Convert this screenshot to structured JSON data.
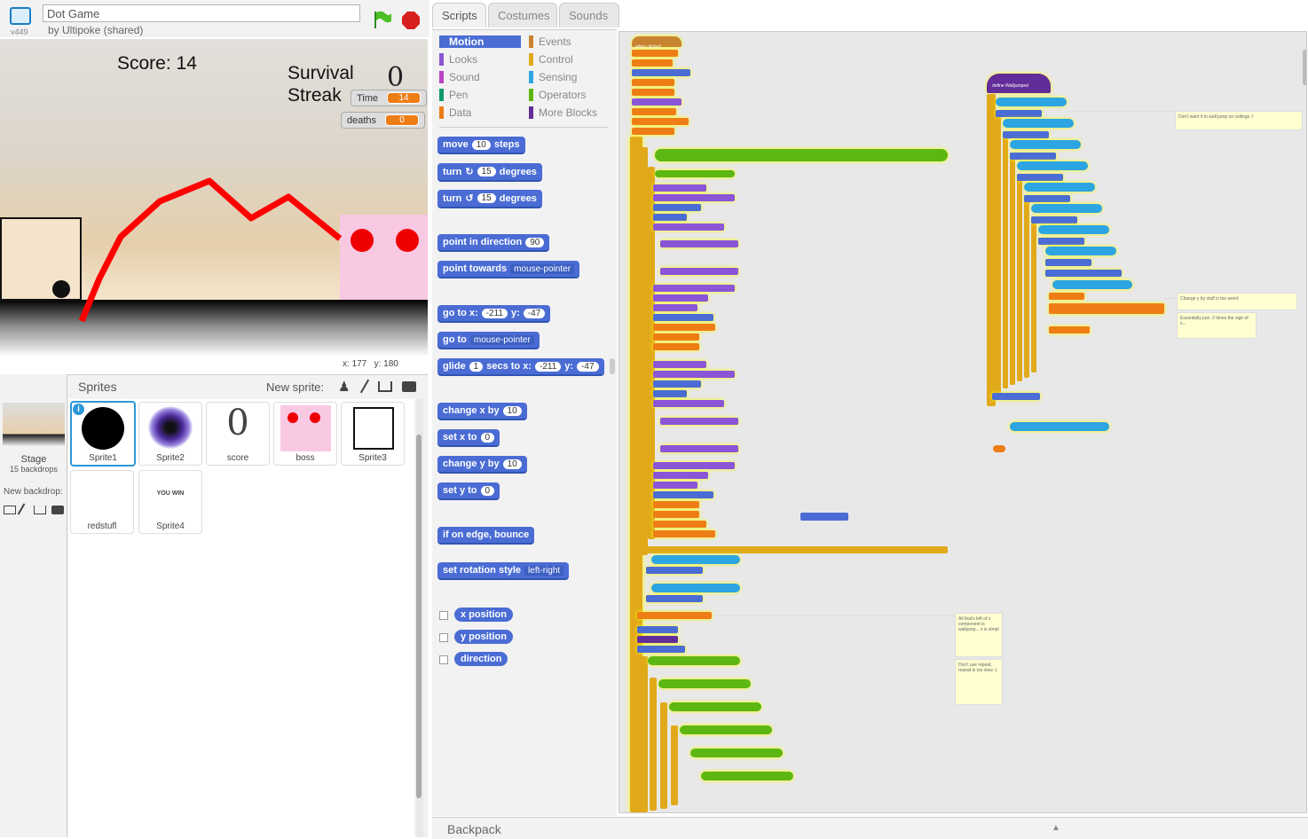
{
  "project": {
    "title": "Dot Game",
    "author": "by Ultipoke (shared)",
    "version": "v449"
  },
  "stage": {
    "score_label": "Score: 14",
    "survival_line1": "Survival",
    "survival_line2": "Streak",
    "streak_value": "0",
    "monitors": [
      {
        "label": "Time",
        "value": "14"
      },
      {
        "label": "deaths",
        "value": "0"
      }
    ],
    "coords": {
      "x_label": "x:",
      "x": "177",
      "y_label": "y:",
      "y": "180"
    }
  },
  "sprites_panel": {
    "header": "Sprites",
    "new_sprite_label": "New sprite:",
    "stage_name": "Stage",
    "stage_backdrops": "15 backdrops",
    "new_backdrop_label": "New backdrop:",
    "sprites": [
      {
        "name": "Sprite1",
        "selected": true
      },
      {
        "name": "Sprite2"
      },
      {
        "name": "score",
        "glyph": "0"
      },
      {
        "name": "boss"
      },
      {
        "name": "Sprite3"
      },
      {
        "name": "redstufl"
      },
      {
        "name": "Sprite4",
        "thumb_text": "YOU WIN"
      }
    ]
  },
  "tabs": [
    "Scripts",
    "Costumes",
    "Sounds"
  ],
  "categories": {
    "left": [
      {
        "label": "Motion",
        "color": "#4a6cd4"
      },
      {
        "label": "Looks",
        "color": "#8a55d7"
      },
      {
        "label": "Sound",
        "color": "#bb42c3"
      },
      {
        "label": "Pen",
        "color": "#0e9a6c"
      },
      {
        "label": "Data",
        "color": "#ee7d16"
      }
    ],
    "right": [
      {
        "label": "Events",
        "color": "#c88330"
      },
      {
        "label": "Control",
        "color": "#e1a91a"
      },
      {
        "label": "Sensing",
        "color": "#2ca5e2"
      },
      {
        "label": "Operators",
        "color": "#5cb712"
      },
      {
        "label": "More Blocks",
        "color": "#632d99"
      }
    ]
  },
  "palette": {
    "move": {
      "a": "move",
      "v": "10",
      "b": "steps"
    },
    "turn_cw": {
      "a": "turn",
      "v": "15",
      "b": "degrees"
    },
    "turn_ccw": {
      "a": "turn",
      "v": "15",
      "b": "degrees"
    },
    "point_dir": {
      "a": "point in direction",
      "v": "90"
    },
    "point_towards": {
      "a": "point towards",
      "v": "mouse-pointer"
    },
    "goto_xy": {
      "a": "go to x:",
      "x": "-211",
      "b": "y:",
      "y": "-47"
    },
    "goto": {
      "a": "go to",
      "v": "mouse-pointer"
    },
    "glide": {
      "a": "glide",
      "s": "1",
      "b": "secs to x:",
      "x": "-211",
      "c": "y:",
      "y": "-47"
    },
    "change_x": {
      "a": "change x by",
      "v": "10"
    },
    "set_x": {
      "a": "set x to",
      "v": "0"
    },
    "change_y": {
      "a": "change y by",
      "v": "10"
    },
    "set_y": {
      "a": "set y to",
      "v": "0"
    },
    "bounce": {
      "a": "if on edge, bounce"
    },
    "rotation": {
      "a": "set rotation style",
      "v": "left-right"
    },
    "reporters": [
      "x position",
      "y position",
      "direction"
    ]
  },
  "scripts": {
    "hat_label": "when clicked",
    "define_label": "define Walljumped",
    "notes": [
      "Don't want it to wall jump on ceilings :/",
      "Change y by stuff is too weird",
      "Essentially just -2 times the sign of x...",
      "All that's left of x component is walljump... x is simpl",
      "Don't use repeat, repeat is too slow :("
    ]
  },
  "backpack_label": "Backpack"
}
